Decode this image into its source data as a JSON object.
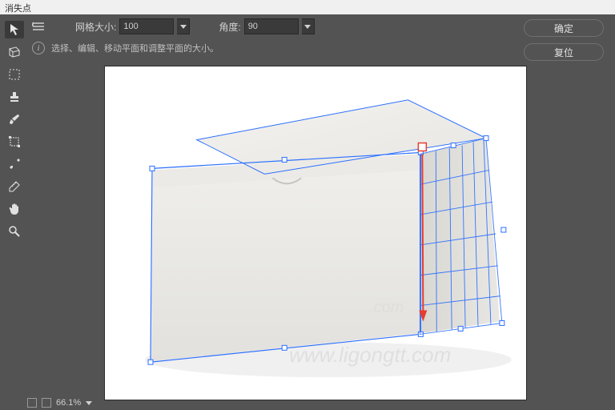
{
  "title": "消失点",
  "options": {
    "grid_label": "网格大小:",
    "grid_value": "100",
    "angle_label": "角度:",
    "angle_value": "90"
  },
  "hint": "选择、编辑、移动平面和调整平面的大小。",
  "buttons": {
    "ok": "确定",
    "reset": "复位"
  },
  "status": {
    "zoom": "66.1%"
  },
  "tools": [
    {
      "name": "arrow-icon"
    },
    {
      "name": "create-plane-icon"
    },
    {
      "name": "marquee-icon"
    },
    {
      "name": "stamp-icon"
    },
    {
      "name": "brush-icon"
    },
    {
      "name": "transform-icon"
    },
    {
      "name": "eyedropper-icon"
    },
    {
      "name": "measure-icon"
    },
    {
      "name": "hand-icon"
    },
    {
      "name": "zoom-icon"
    }
  ],
  "watermark": "www.ligongtt.com"
}
